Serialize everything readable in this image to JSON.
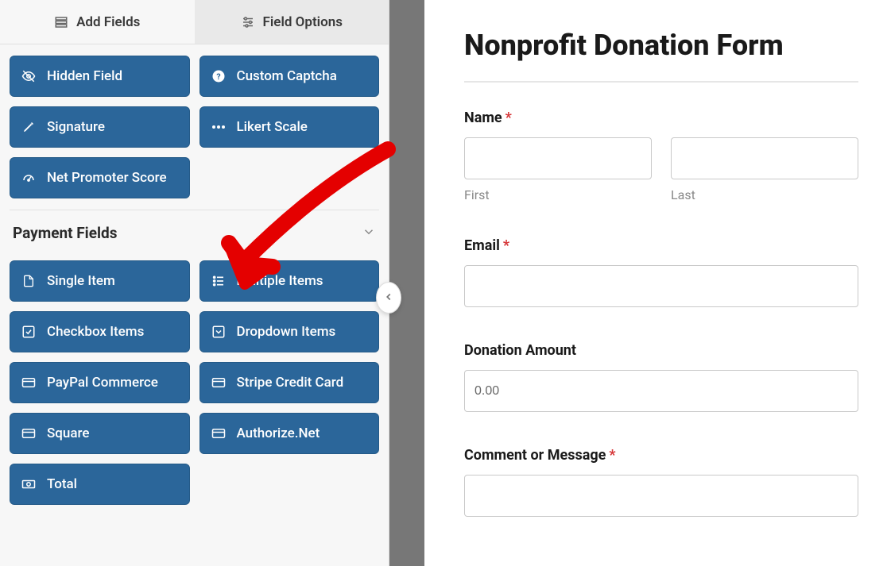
{
  "tabs": {
    "add_fields": "Add Fields",
    "field_options": "Field Options"
  },
  "fields": {
    "hidden_field": "Hidden Field",
    "custom_captcha": "Custom Captcha",
    "signature": "Signature",
    "likert_scale": "Likert Scale",
    "net_promoter_score": "Net Promoter Score"
  },
  "section": {
    "payment_fields": "Payment Fields"
  },
  "payment_fields": {
    "single_item": "Single Item",
    "multiple_items": "Multiple Items",
    "checkbox_items": "Checkbox Items",
    "dropdown_items": "Dropdown Items",
    "paypal_commerce": "PayPal Commerce",
    "stripe_credit_card": "Stripe Credit Card",
    "square": "Square",
    "authorize_net": "Authorize.Net",
    "total": "Total"
  },
  "form": {
    "title": "Nonprofit Donation Form",
    "name_label": "Name",
    "first_label": "First",
    "last_label": "Last",
    "email_label": "Email",
    "donation_amount_label": "Donation Amount",
    "donation_amount_value": "0.00",
    "comment_label": "Comment or Message"
  }
}
